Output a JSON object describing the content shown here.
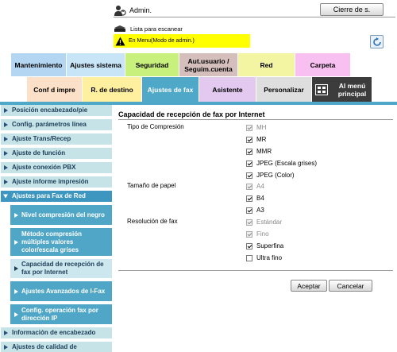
{
  "header": {
    "user_label": "Admin.",
    "logout_label": "Cierre de s.",
    "queue_label": "Lista para escanear",
    "mode_label": "En Menu(Modo de admin.)"
  },
  "tabs_row1": [
    {
      "label": "Mantenimiento"
    },
    {
      "label": "Ajustes sistema"
    },
    {
      "label": "Seguridad"
    },
    {
      "label": "Aut.usuario / Seguim.cuenta"
    },
    {
      "label": "Red"
    },
    {
      "label": "Carpeta"
    }
  ],
  "tabs_row2": [
    {
      "label": "Conf d impre"
    },
    {
      "label": "R. de destino"
    },
    {
      "label": "Ajustes de fax"
    },
    {
      "label": "Asistente"
    },
    {
      "label": "Personalizar"
    },
    {
      "label": "Al menú principal"
    }
  ],
  "sidebar": {
    "items": [
      {
        "label": "Posición encabezado/pie"
      },
      {
        "label": "Config. parámetros línea"
      },
      {
        "label": "Ajuste Trans/Recep"
      },
      {
        "label": "Ajuste de función"
      },
      {
        "label": "Ajuste conexión PBX"
      },
      {
        "label": "Ajuste informe impresión"
      },
      {
        "label": "Ajustes para Fax de Red"
      },
      {
        "label": "Información de encabezado"
      },
      {
        "label": "Ajustes de calidad de"
      }
    ],
    "subitems": [
      {
        "label": "Nivel compresión del negro"
      },
      {
        "label": "Método compresión múltiples valores color/escala grises"
      },
      {
        "label": "Capacidad de recepción de fax por Internet"
      },
      {
        "label": "Ajustes Avanzados de I-Fax"
      },
      {
        "label": "Config. operación fax por dirección IP"
      }
    ]
  },
  "content": {
    "title": "Capacidad de recepción de fax por Internet",
    "groups": [
      {
        "label": "Tipo de Compresión",
        "options": [
          {
            "label": "MH",
            "checked": true,
            "disabled": true
          },
          {
            "label": "MR",
            "checked": true,
            "disabled": false
          },
          {
            "label": "MMR",
            "checked": true,
            "disabled": false
          },
          {
            "label": "JPEG (Escala grises)",
            "checked": true,
            "disabled": false
          },
          {
            "label": "JPEG (Color)",
            "checked": true,
            "disabled": false
          }
        ]
      },
      {
        "label": "Tamaño de papel",
        "options": [
          {
            "label": "A4",
            "checked": true,
            "disabled": true
          },
          {
            "label": "B4",
            "checked": true,
            "disabled": false
          },
          {
            "label": "A3",
            "checked": true,
            "disabled": false
          }
        ]
      },
      {
        "label": "Resolución de fax",
        "options": [
          {
            "label": "Estándar",
            "checked": true,
            "disabled": true
          },
          {
            "label": "Fino",
            "checked": true,
            "disabled": true
          },
          {
            "label": "Superfina",
            "checked": true,
            "disabled": false
          },
          {
            "label": "Ultra fino",
            "checked": false,
            "disabled": false
          }
        ]
      }
    ],
    "ok_label": "Aceptar",
    "cancel_label": "Cancelar"
  }
}
